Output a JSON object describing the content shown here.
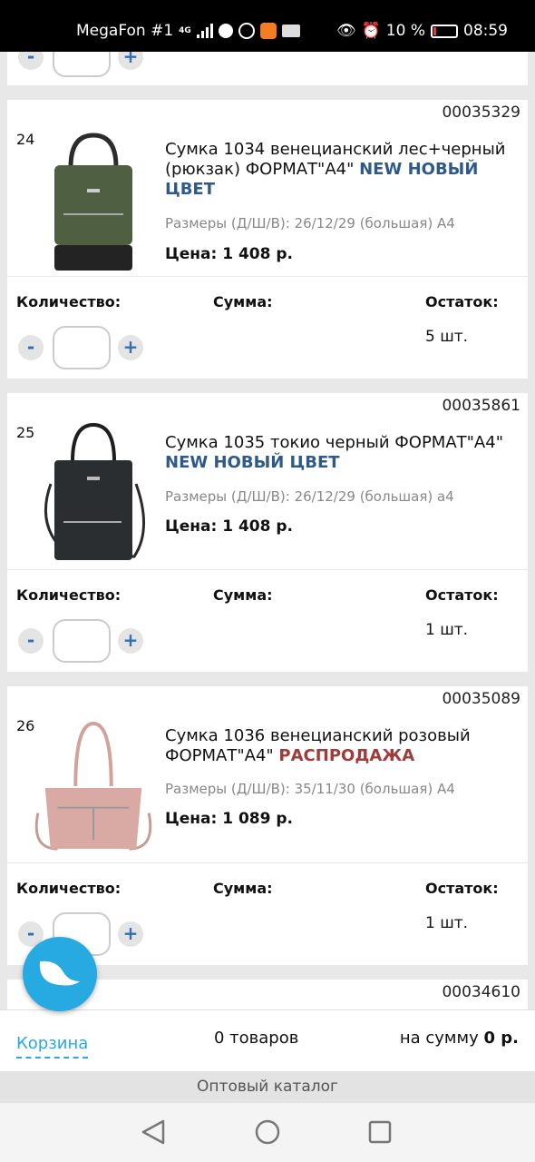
{
  "status_bar": {
    "carrier": "MegaFon #1",
    "network": "4G",
    "battery": "10 %",
    "time": "08:59"
  },
  "products": [
    {
      "code": "00035329",
      "index": "24",
      "title": "Сумка 1034 венецианский лес+черный (рюкзак) ФОРМАТ\"А4\"",
      "tag": "NEW НОВЫЙ ЦВЕТ",
      "sizes": "Размеры (Д/Ш/В): 26/12/29 (большая) А4",
      "price": "Цена: 1 408 р.",
      "stock": "5 шт.",
      "bag_color": "#4f5f42"
    },
    {
      "code": "00035861",
      "index": "25",
      "title": "Сумка 1035 токио черный ФОРМАТ\"А4\"",
      "tag": "NEW НОВЫЙ ЦВЕТ",
      "sizes": "Размеры (Д/Ш/В): 26/12/29 (большая) а4",
      "price": "Цена: 1 408 р.",
      "stock": "1 шт.",
      "bag_color": "#2a2e31"
    },
    {
      "code": "00035089",
      "index": "26",
      "title": "Сумка 1036 венецианский розовый ФОРМАТ\"А4\"",
      "tag": "РАСПРОДАЖА",
      "sizes": "Размеры (Д/Ш/В): 35/11/30 (большая) А4",
      "price": "Цена: 1 089 р.",
      "stock": "1 шт.",
      "bag_color": "#d9aaa4"
    },
    {
      "code": "00034610"
    }
  ],
  "labels": {
    "quantity": "Количество:",
    "sum": "Сумма:",
    "stock": "Остаток:",
    "minus": "-",
    "plus": "+"
  },
  "cart": {
    "link": "Корзина",
    "count": "0 товаров",
    "sum_label": "на сумму",
    "sum_value": "0 р."
  },
  "footer": "Оптовый каталог",
  "colors": {
    "accent": "#27a9e1",
    "tag_new": "#2e5a8a",
    "tag_sale": "#a33a3a"
  }
}
